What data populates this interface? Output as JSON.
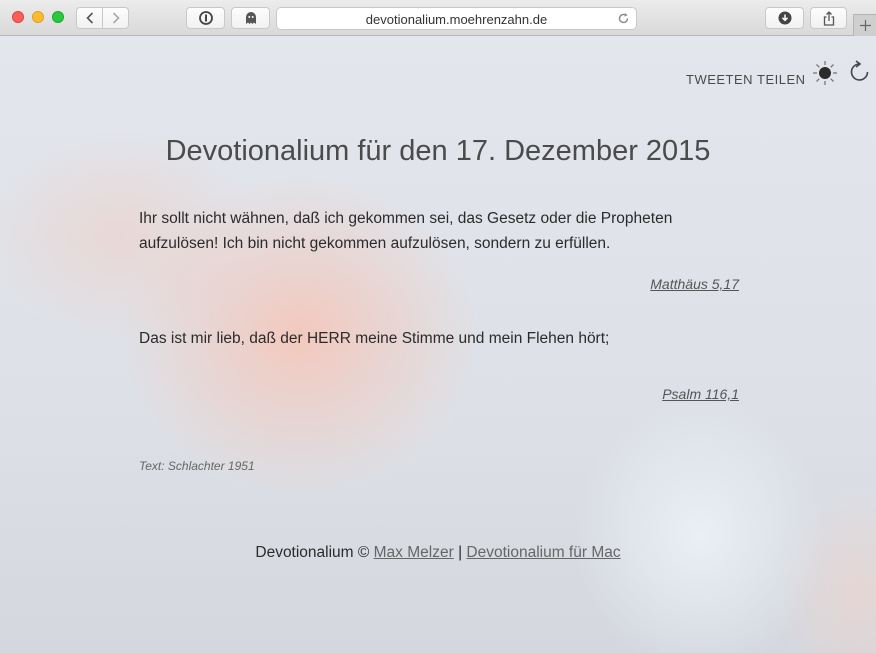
{
  "browser": {
    "url": "devotionalium.moehrenzahn.de"
  },
  "header": {
    "tweet_label": "TWEETEN",
    "share_label": "TEILEN"
  },
  "main": {
    "title": "Devotionalium für den 17. Dezember 2015",
    "verses": [
      {
        "line1": "Ihr sollt nicht wähnen, daß ich gekommen sei, das Gesetz oder die Propheten",
        "line2": "aufzulösen! Ich bin nicht gekommen aufzulösen, sondern zu erfüllen.",
        "reference": "Matthäus 5,17"
      },
      {
        "line1": "Das ist mir lieb, daß der HERR meine Stimme und mein Flehen hört;",
        "reference": "Psalm 116,1"
      }
    ],
    "translation": "Text: Schlachter 1951"
  },
  "footer": {
    "brand": "Devotionalium ©",
    "author_link": "Max Melzer",
    "separator": "|",
    "mac_link": "Devotionalium für Mac"
  },
  "colors": {
    "accent_red": "#fc5f57",
    "accent_yellow": "#fdbc2e",
    "accent_green": "#28c840",
    "text": "#2b2b2b"
  }
}
